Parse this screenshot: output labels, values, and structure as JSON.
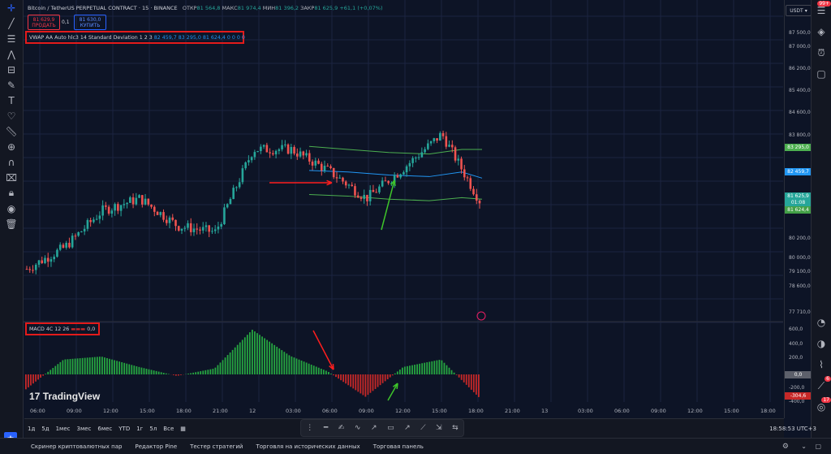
{
  "symbol": {
    "title": "Bitcoin / TetherUS PERPETUAL CONTRACT · 15 · BINANCE",
    "ohlc_label": "ОТКР",
    "open": "81 564,8",
    "high_label": "МАКС",
    "high": "81 974,4",
    "low_label": "МИН",
    "low": "81 396,2",
    "close_label": "ЗАКР",
    "close": "81 625,9",
    "change": "+61,1 (+0,07%)"
  },
  "trade": {
    "sell_price": "81 629,9",
    "sell_label": "ПРОДАТЬ",
    "spread": "0,1",
    "buy_price": "81 630,0",
    "buy_label": "КУПИТЬ"
  },
  "indicators": {
    "vwap_label": "VWAP AA Auto hlc3 14 Standard Deviation 1 2 3",
    "vwap_values": "82 459,7  83 295,0  81 624,4  0  0  0  0",
    "macd_label": "MACD 4C 12 26",
    "macd_value": "0,0"
  },
  "price_axis": {
    "currency": "USDT",
    "labels": [
      "87 500,0",
      "87 000,0",
      "86 200,0",
      "85 400,0",
      "84 600,0",
      "83 800,0",
      "80 200,0",
      "80 000,0",
      "79 100,0",
      "78 600,0",
      "77 710,0"
    ],
    "tag_upper": "83 295,0",
    "tag_vwap": "82 459,7",
    "tag_close": "81 625,9",
    "tag_countdown": "01:08",
    "tag_lower": "81 624,4"
  },
  "macd_axis": {
    "labels": [
      "600,0",
      "400,0",
      "200,0",
      "-200,0",
      "-400,0"
    ],
    "tag_zero": "0,0",
    "tag_value": "-304,6"
  },
  "time_axis": [
    "06:00",
    "09:00",
    "12:00",
    "15:00",
    "18:00",
    "21:00",
    "12",
    "03:00",
    "06:00",
    "09:00",
    "12:00",
    "15:00",
    "18:00",
    "21:00",
    "13",
    "03:00",
    "06:00",
    "09:00",
    "12:00",
    "15:00",
    "18:00"
  ],
  "timeframes": [
    "1д",
    "5д",
    "1мес",
    "3мес",
    "6мес",
    "YTD",
    "1г",
    "5л",
    "Все"
  ],
  "clock": "18:58:53 UTC+3",
  "bottom_tabs": [
    "Скринер криптовалютных пар",
    "Редактор Pine",
    "Тестер стратегий",
    "Торговля на исторических данных",
    "Торговая панель"
  ],
  "notifications": {
    "top": "99+",
    "bottom_a": "6",
    "bottom_b": "17"
  },
  "logo": "TradingView",
  "colors": {
    "background": "#0d1426",
    "up_candle": "#26a69a",
    "down_candle": "#ef5350",
    "vwap": "#2196f3",
    "upper_band": "#4caf50",
    "macd_up": "#26a641",
    "macd_down": "#c62828",
    "annotation_red": "#ff1e1e",
    "annotation_green": "#3ec52a"
  },
  "chart_data": {
    "type": "candlestick",
    "interval": "15",
    "ylim": [
      77710,
      87900
    ],
    "x": [
      "06:00",
      "09:00",
      "12:00",
      "15:00",
      "18:00",
      "21:00",
      "12",
      "03:00",
      "06:00",
      "09:00",
      "12:00",
      "15:00",
      "18:00"
    ],
    "close_approx": [
      79400,
      80100,
      81300,
      81700,
      80800,
      80600,
      83300,
      83300,
      82600,
      81700,
      82700,
      83800,
      81626
    ],
    "vwap": {
      "mid": 82459.7,
      "upper": 83295.0,
      "lower": 81624.4
    },
    "macd_range": [
      -400,
      600
    ],
    "macd_hist_approx": [
      -200,
      200,
      240,
      100,
      -20,
      80,
      600,
      250,
      40,
      -300,
      100,
      200,
      -304.6
    ]
  }
}
